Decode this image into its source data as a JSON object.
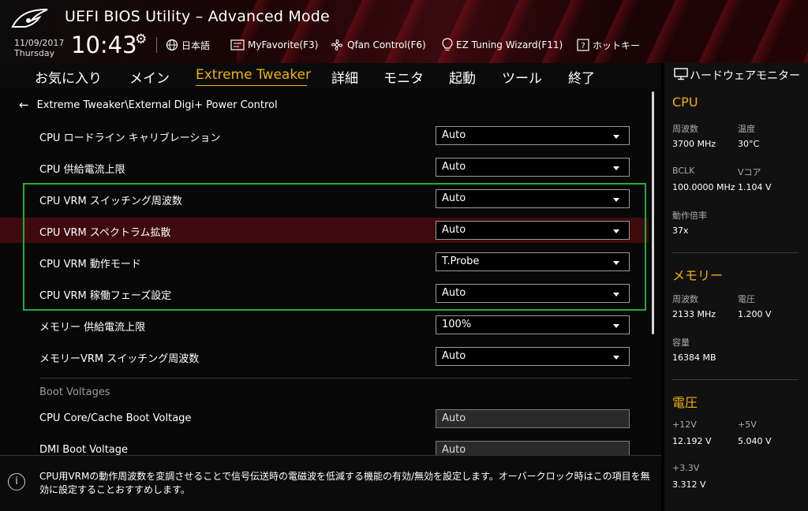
{
  "header": {
    "title": "UEFI BIOS Utility – Advanced Mode",
    "date": "11/09/2017",
    "day": "Thursday",
    "time": "10:43",
    "items": [
      {
        "label": "日本語",
        "icon": "globe-icon"
      },
      {
        "label": "MyFavorite(F3)",
        "icon": "favorite-icon"
      },
      {
        "label": "Qfan Control(F6)",
        "icon": "fan-icon"
      },
      {
        "label": "EZ Tuning Wizard(F11)",
        "icon": "bulb-icon"
      },
      {
        "label": "ホットキー",
        "icon": "hotkey-icon"
      }
    ]
  },
  "menu": {
    "items": [
      "お気に入り",
      "メイン",
      "Extreme Tweaker",
      "詳細",
      "モニタ",
      "起動",
      "ツール",
      "終了"
    ],
    "active": "Extreme Tweaker"
  },
  "breadcrumb": "Extreme Tweaker\\External Digi+ Power Control",
  "settings": [
    {
      "label": "CPU ロードライン キャリブレーション",
      "value": "Auto"
    },
    {
      "label": "CPU 供給電流上限",
      "value": "Auto"
    },
    {
      "label": "CPU VRM スイッチング周波数",
      "value": "Auto"
    },
    {
      "label": "CPU VRM スペクトラム拡散",
      "value": "Auto"
    },
    {
      "label": "CPU VRM 動作モード",
      "value": "T.Probe"
    },
    {
      "label": "CPU VRM 稼働フェーズ設定",
      "value": "Auto"
    },
    {
      "label": "メモリー 供給電流上限",
      "value": "100%"
    },
    {
      "label": "メモリーVRM スイッチング周波数",
      "value": "Auto"
    }
  ],
  "boot_section": {
    "title": "Boot Voltages",
    "items": [
      {
        "label": "CPU Core/Cache Boot Voltage",
        "value": "Auto"
      },
      {
        "label": "DMI Boot Voltage",
        "value": "Auto"
      }
    ]
  },
  "help_text": "CPU用VRMの動作周波数を変調させることで信号伝送時の電磁波を低減する機能の有効/無効を設定します。オーバークロック時はこの項目を無効に設定することおすすめします。",
  "hw_monitor": {
    "title": "ハードウェアモニター",
    "cpu": {
      "title": "CPU",
      "freq_label": "周波数",
      "freq": "3700 MHz",
      "temp_label": "温度",
      "temp": "30°C",
      "bclk_label": "BCLK",
      "bclk": "100.0000 MHz",
      "vcore_label": "Vコア",
      "vcore": "1.104 V",
      "ratio_label": "動作倍率",
      "ratio": "37x"
    },
    "memory": {
      "title": "メモリー",
      "freq_label": "周波数",
      "freq": "2133 MHz",
      "volt_label": "電圧",
      "volt": "1.200 V",
      "cap_label": "容量",
      "cap": "16384 MB"
    },
    "voltage": {
      "title": "電圧",
      "v12_label": "+12V",
      "v12": "12.192 V",
      "v5_label": "+5V",
      "v5": "5.040 V",
      "v33_label": "+3.3V",
      "v33": "3.312 V"
    }
  },
  "colors": {
    "accent": "#f0b20a",
    "highlight_row": "#3e0a0e",
    "selection_box": "#1fae3e"
  }
}
